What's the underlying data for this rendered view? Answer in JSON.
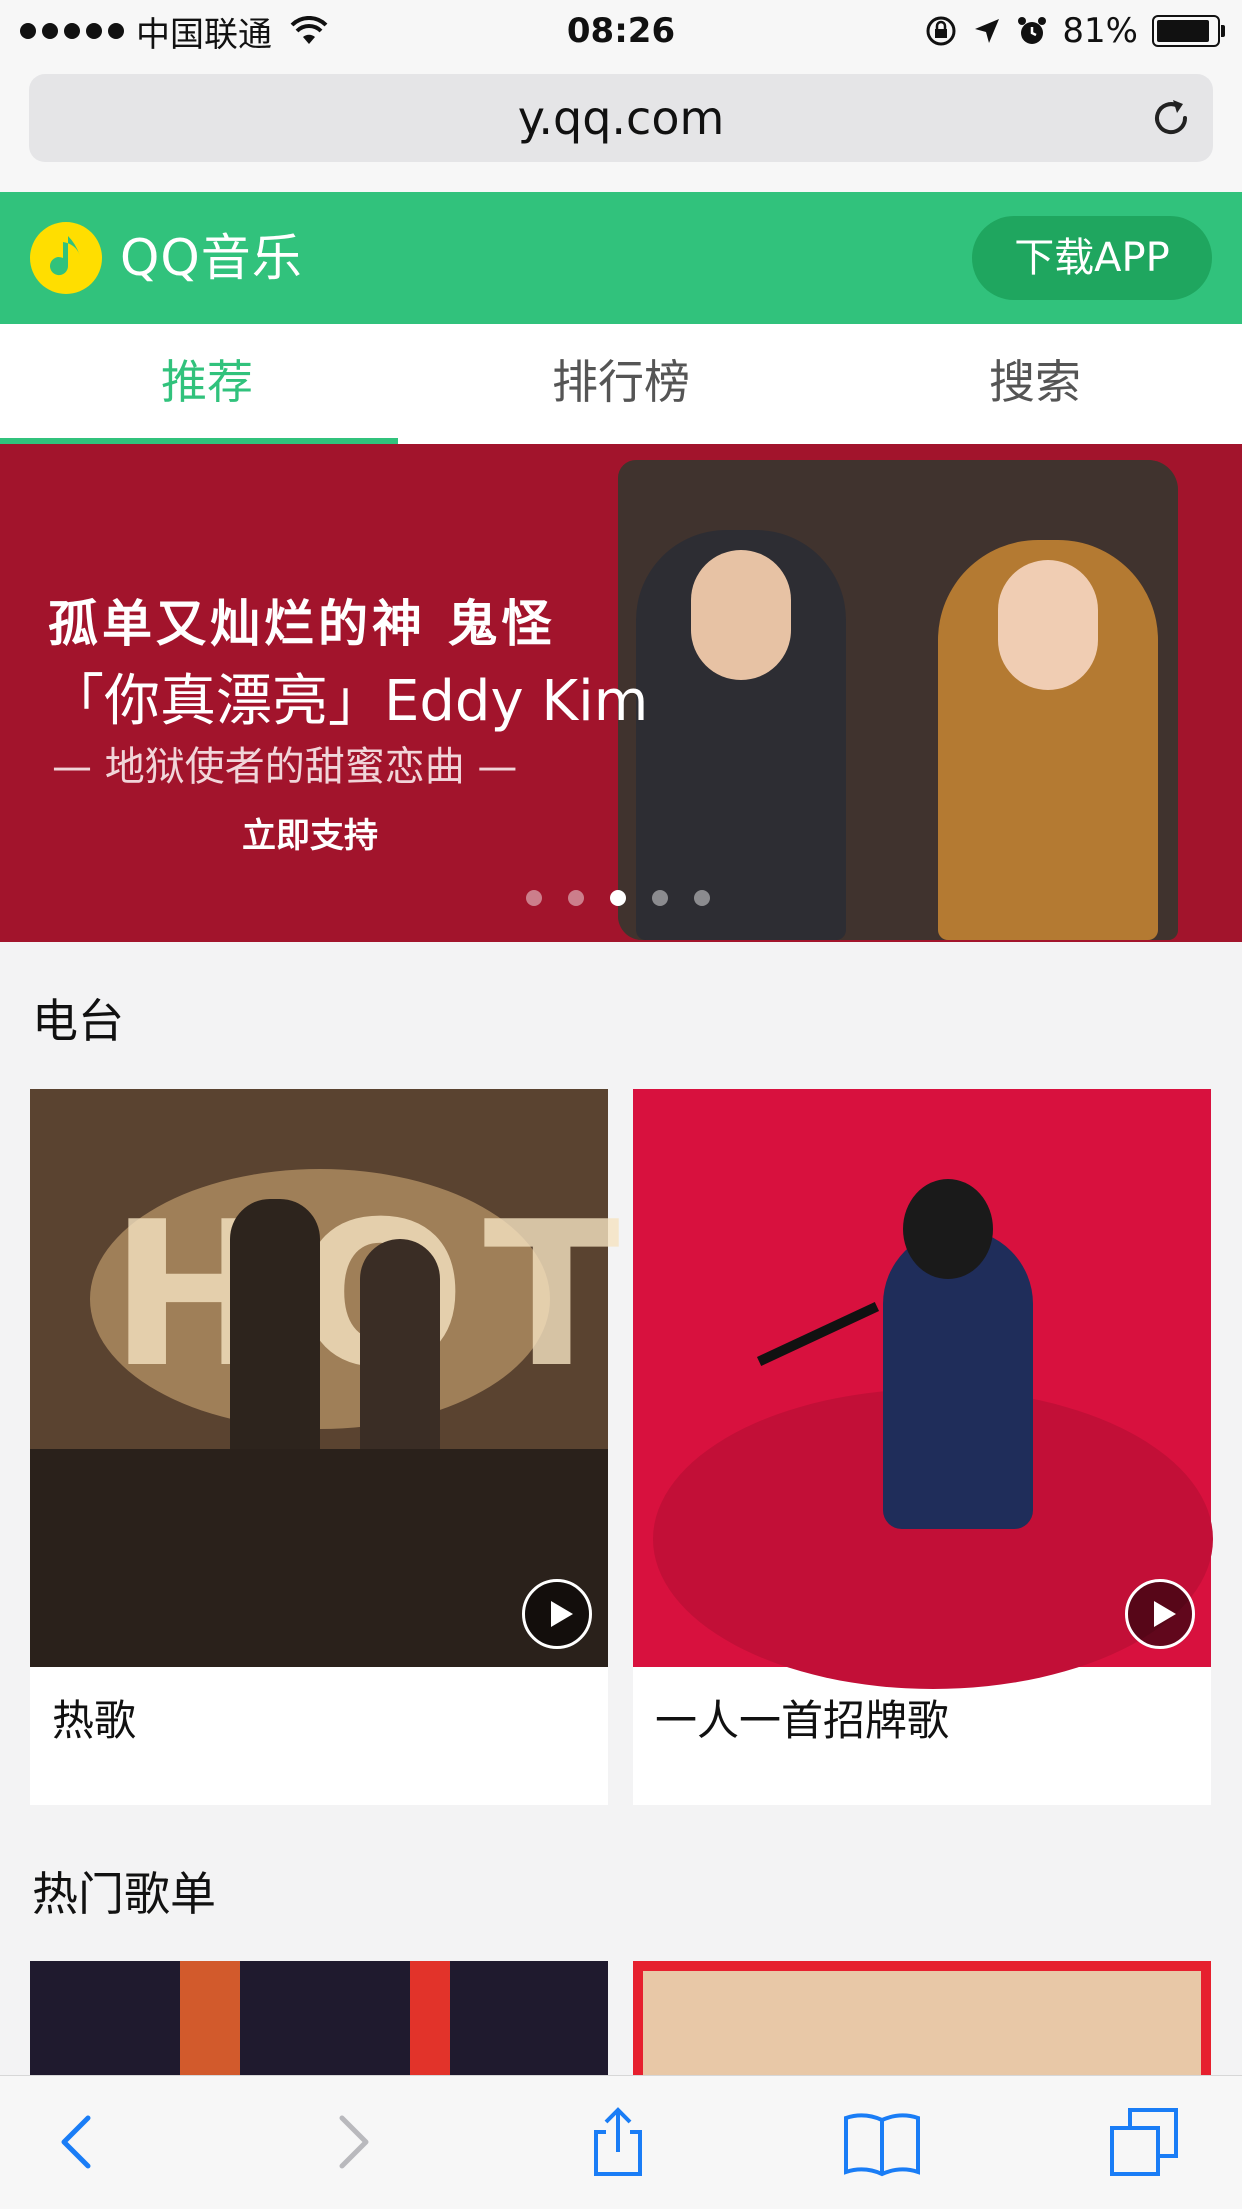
{
  "status_bar": {
    "carrier": "中国联通",
    "time": "08:26",
    "battery": "81%",
    "battery_level": 0.81,
    "icons": [
      "signal-dots-icon",
      "wifi-icon",
      "rotation-lock-icon",
      "location-icon",
      "alarm-icon",
      "battery-icon"
    ]
  },
  "browser": {
    "url": "y.qq.com",
    "toolbar": [
      "back-icon",
      "forward-icon",
      "share-icon",
      "bookmarks-icon",
      "tabs-icon"
    ]
  },
  "header": {
    "logo_text": "QQ音乐",
    "download_label": "下载APP",
    "brand_color": "#31c27c"
  },
  "tabs": [
    {
      "label": "推荐",
      "active": true
    },
    {
      "label": "排行榜",
      "active": false
    },
    {
      "label": "搜索",
      "active": false
    }
  ],
  "banner": {
    "line1": "孤单又灿烂的神 鬼怪",
    "line2": "「你真漂亮」Eddy Kim",
    "line3": "— 地狱使者的甜蜜恋曲 —",
    "line4": "立即支持",
    "pages": 5,
    "active_page": 3
  },
  "radio": {
    "title": "电台",
    "items": [
      {
        "label": "热歌"
      },
      {
        "label": "一人一首招牌歌"
      }
    ]
  },
  "playlists": {
    "title": "热门歌单"
  }
}
